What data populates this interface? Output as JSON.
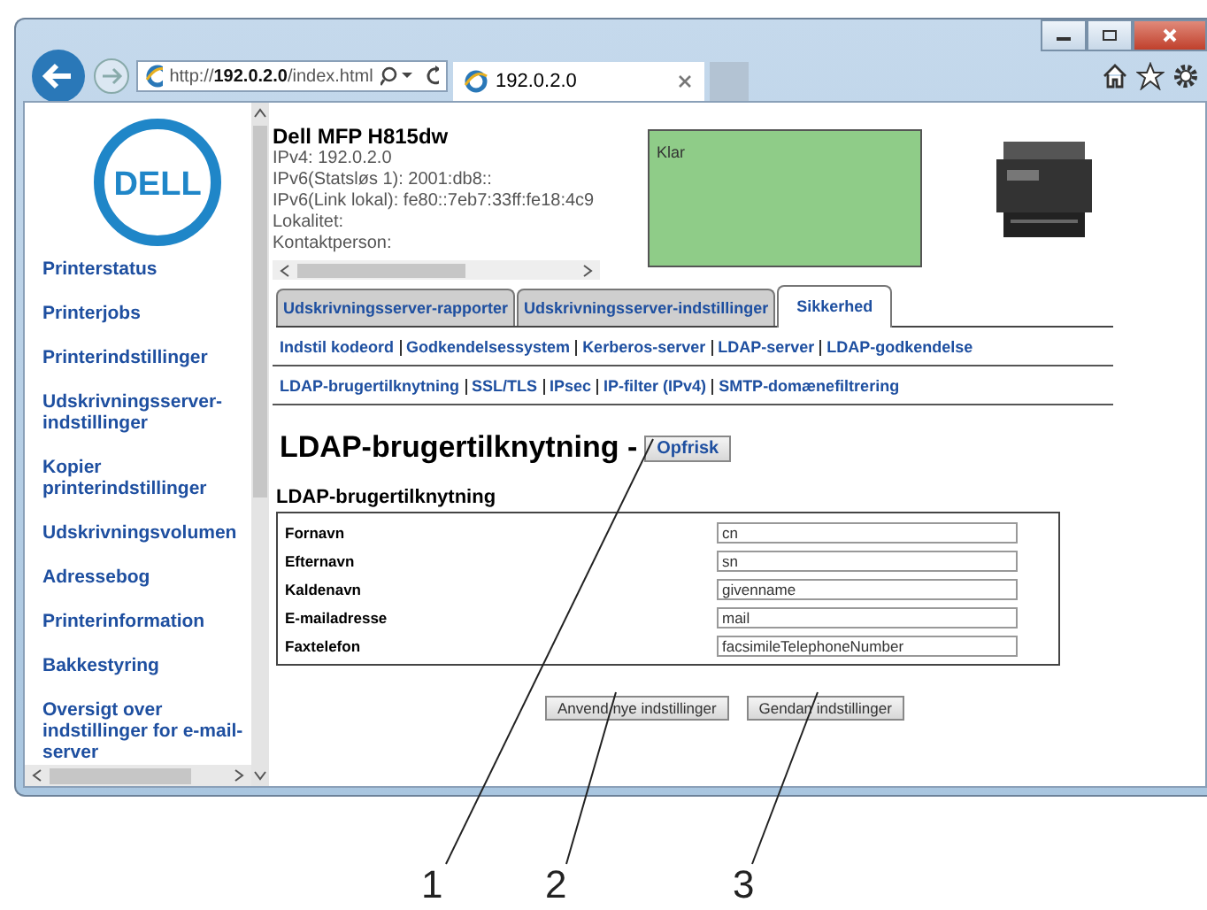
{
  "browser": {
    "address": "http://**192.0.2.0**/index.html",
    "tabs": [
      {
        "title": "192.0.2.0",
        "selected": true
      }
    ]
  },
  "logo": "DELL",
  "sidebar": {
    "items": [
      "Printerstatus",
      "Printerjobs",
      "Printerindstillinger",
      "Udskrivningsserver-indstillinger",
      "Kopier printerindstillinger",
      "Udskrivningsvolumen",
      "Adressebog",
      "Printerinformation",
      "Bakkestyring",
      "Oversigt over indstillinger for e-mail-server"
    ]
  },
  "header": {
    "model": "Dell MFP H815dw",
    "info_lines": [
      "IPv4: 192.0.2.0",
      "IPv6(Statsløs 1): 2001:db8::",
      "IPv6(Link lokal): fe80::7eb7:33ff:fe18:4c9",
      "Lokalitet:",
      "Kontaktperson:"
    ],
    "status": "Klar"
  },
  "tabs": [
    {
      "label": "Udskrivningsserver-rapporter",
      "selected": false
    },
    {
      "label": "Udskrivningsserver-indstillinger",
      "selected": false
    },
    {
      "label": "Sikkerhed",
      "selected": true
    }
  ],
  "subnav": [
    [
      "Indstil kodeord",
      "Godkendelsessystem",
      "Kerberos-server",
      "LDAP-server",
      "LDAP-godkendelse"
    ],
    [
      "LDAP-brugertilknytning",
      "SSL/TLS",
      "IPsec",
      "IP-filter (IPv4)",
      "SMTP-domænefiltrering"
    ]
  ],
  "page_title": "LDAP-brugertilknytning -",
  "refresh_button": "Opfrisk",
  "section_title": "LDAP-brugertilknytning",
  "fields": [
    {
      "label": "Fornavn",
      "value": "cn"
    },
    {
      "label": "Efternavn",
      "value": "sn"
    },
    {
      "label": "Kaldenavn",
      "value": "givenname"
    },
    {
      "label": "E-mailadresse",
      "value": "mail"
    },
    {
      "label": "Faxtelefon",
      "value": "facsimileTelephoneNumber"
    }
  ],
  "buttons": [
    "Anvend nye indstillinger",
    "Gendan indstillinger"
  ],
  "callouts": [
    "1",
    "2",
    "3"
  ]
}
